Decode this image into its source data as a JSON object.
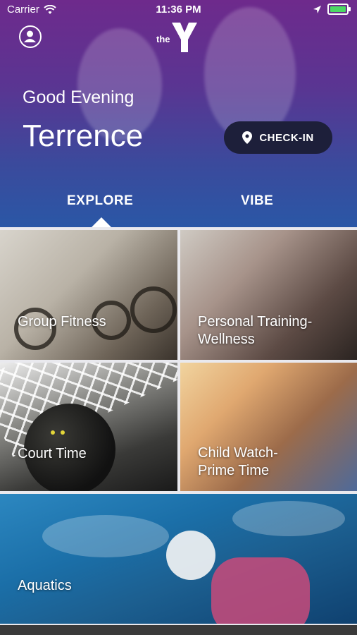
{
  "status_bar": {
    "carrier": "Carrier",
    "time": "11:36 PM"
  },
  "header": {
    "logo_text": "the",
    "greeting": "Good Evening",
    "user_name": "Terrence",
    "checkin_label": "CHECK-IN"
  },
  "tabs": [
    {
      "label": "EXPLORE",
      "selected": true
    },
    {
      "label": "VIBE",
      "selected": false
    }
  ],
  "tiles": [
    {
      "label": "Group Fitness"
    },
    {
      "label": "Personal Training-\nWellness"
    },
    {
      "label": "Court Time"
    },
    {
      "label": "Child Watch-\nPrime Time"
    },
    {
      "label": "Aquatics"
    }
  ],
  "colors": {
    "hero_top": "#6e2a8c",
    "hero_bottom": "#2a57a6",
    "checkin_bg": "#1d1f3a",
    "battery_green": "#4cd964"
  }
}
